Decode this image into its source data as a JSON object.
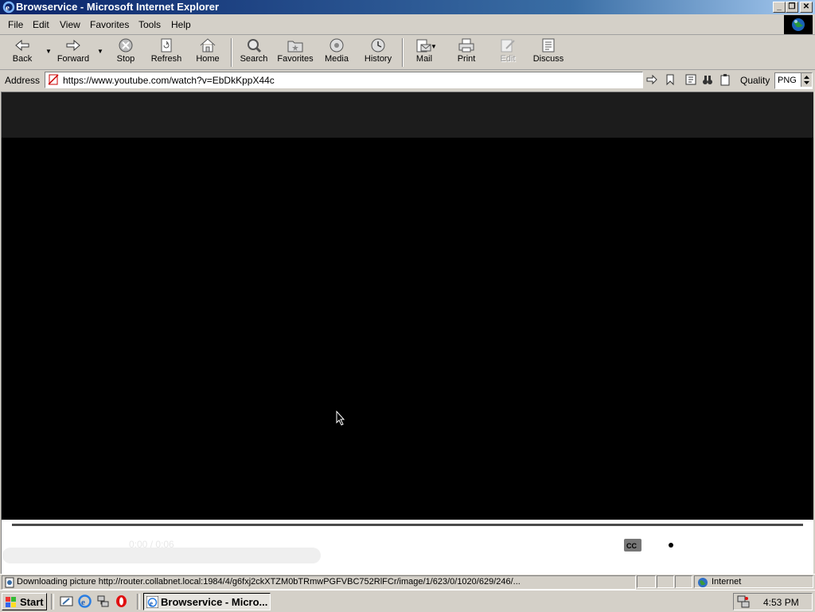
{
  "window": {
    "title": "Browservice - Microsoft Internet Explorer"
  },
  "menu": [
    "File",
    "Edit",
    "View",
    "Favorites",
    "Tools",
    "Help"
  ],
  "toolbar": {
    "back": "Back",
    "forward": "Forward",
    "stop": "Stop",
    "refresh": "Refresh",
    "home": "Home",
    "search": "Search",
    "favorites": "Favorites",
    "media": "Media",
    "history": "History",
    "mail": "Mail",
    "print": "Print",
    "edit": "Edit",
    "discuss": "Discuss"
  },
  "address": {
    "label": "Address",
    "url": "https://www.youtube.com/watch?v=EbDkKppX44c",
    "quality_label": "Quality",
    "quality_value": "PNG"
  },
  "player": {
    "time": "0:00 / 0:06",
    "progress_fraction": 0
  },
  "status": {
    "text": "Downloading picture http://router.collabnet.local:1984/4/g6fxj2ckXTZM0bTRmwPGFVBC752RlFCr/image/1/623/0/1020/629/246/...",
    "zone": "Internet"
  },
  "taskbar": {
    "start": "Start",
    "task": "Browservice - Micro...",
    "clock": "4:53 PM"
  }
}
